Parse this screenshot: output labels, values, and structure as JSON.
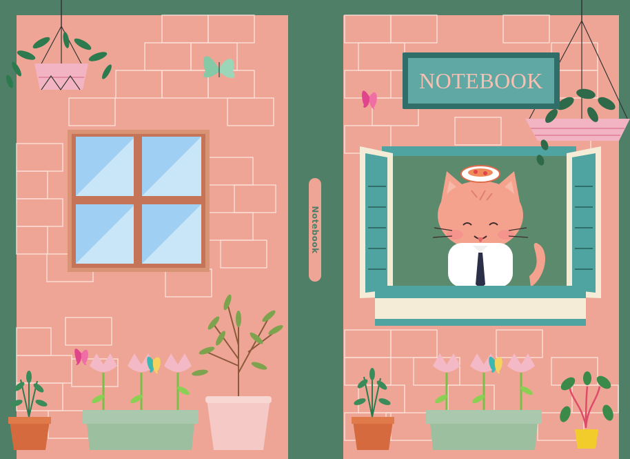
{
  "cover": {
    "title": "NOTEBOOK",
    "spine_label": "Notebook"
  },
  "colors": {
    "frame": "#4f7f67",
    "wall": "#efa596",
    "brick_line": "#fbe4dc",
    "sign_dark": "#2f6e69",
    "sign_light": "#5fa8a3",
    "window_glass": "#9fd0f3",
    "shutter": "#4fa3a0"
  },
  "icons": [
    "hanging-planter-icon",
    "butterfly-icon",
    "window-icon",
    "flower-box-icon",
    "potted-plant-icon",
    "cat-icon",
    "shutter-icon"
  ]
}
